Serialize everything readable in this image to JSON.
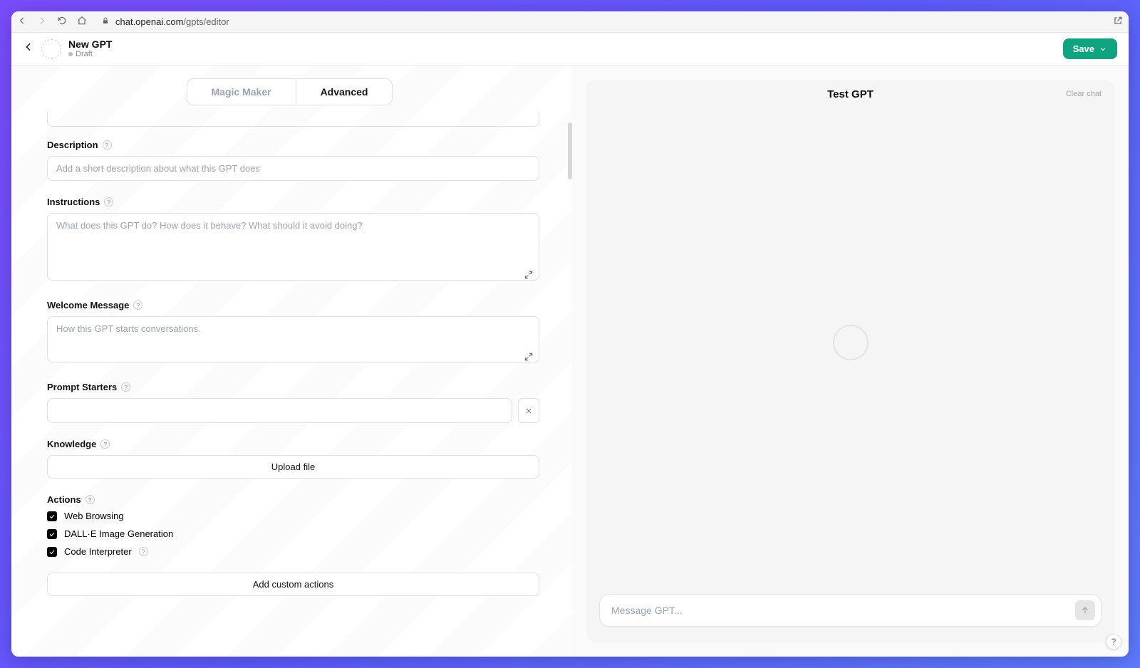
{
  "browser": {
    "url_host": "chat.openai.com",
    "url_path": "/gpts/editor"
  },
  "header": {
    "title": "New GPT",
    "status": "Draft",
    "save_label": "Save"
  },
  "tabs": {
    "magic": "Magic Maker",
    "advanced": "Advanced"
  },
  "fields": {
    "description": {
      "label": "Description",
      "placeholder": "Add a short description about what this GPT does"
    },
    "instructions": {
      "label": "Instructions",
      "placeholder": "What does this GPT do? How does it behave? What should it avoid doing?"
    },
    "welcome": {
      "label": "Welcome Message",
      "placeholder": "How this GPT starts conversations."
    },
    "prompt_starters": {
      "label": "Prompt Starters"
    },
    "knowledge": {
      "label": "Knowledge",
      "upload_label": "Upload file"
    },
    "actions": {
      "label": "Actions",
      "items": [
        "Web Browsing",
        "DALL·E Image Generation",
        "Code Interpreter"
      ],
      "add_custom_label": "Add custom actions"
    }
  },
  "preview": {
    "title": "Test GPT",
    "clear_label": "Clear chat",
    "input_placeholder": "Message GPT..."
  },
  "help_glyph": "?"
}
